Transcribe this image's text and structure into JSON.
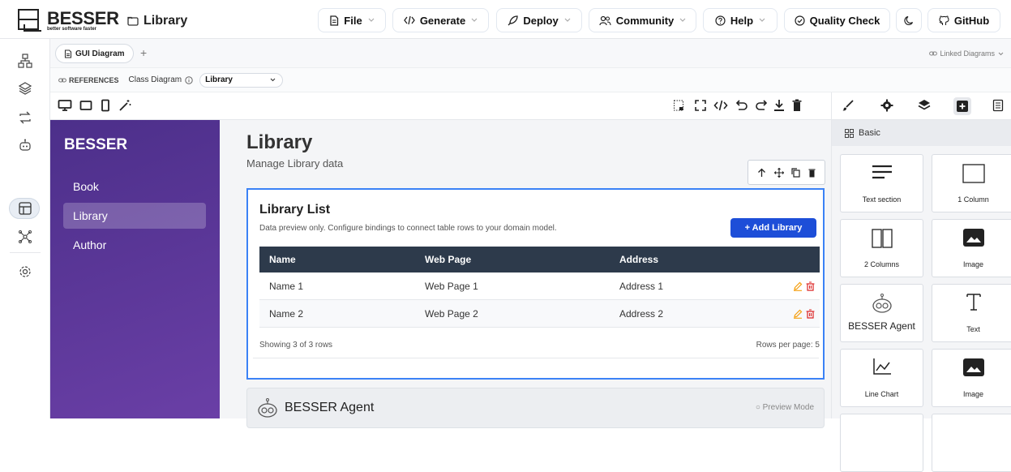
{
  "app": {
    "logo_title": "BESSER",
    "logo_subtitle": "better software faster",
    "project_name": "Library"
  },
  "menu": {
    "file": "File",
    "generate": "Generate",
    "deploy": "Deploy",
    "community": "Community",
    "help": "Help",
    "quality_check": "Quality Check",
    "github": "GitHub"
  },
  "tabs": {
    "active_tab": "GUI Diagram",
    "add": "+",
    "linked_diagrams": "Linked Diagrams"
  },
  "references": {
    "label": "REFERENCES",
    "class_diagram": "Class Diagram",
    "selected": "Library"
  },
  "sidebar": {
    "brand": "BESSER",
    "items": [
      {
        "label": "Book",
        "active": false
      },
      {
        "label": "Library",
        "active": true
      },
      {
        "label": "Author",
        "active": false
      }
    ]
  },
  "page": {
    "title": "Library",
    "subtitle": "Manage Library data"
  },
  "table_card": {
    "title": "Library List",
    "description": "Data preview only. Configure bindings to connect table rows to your domain model.",
    "add_button": "+ Add Library",
    "columns": [
      "Name",
      "Web Page",
      "Address"
    ],
    "rows": [
      [
        "Name 1",
        "Web Page 1",
        "Address 1"
      ],
      [
        "Name 2",
        "Web Page 2",
        "Address 2"
      ]
    ],
    "footer_left": "Showing 3 of 3 rows",
    "footer_right": "Rows per page: 5"
  },
  "agent_card": {
    "title": "BESSER Agent",
    "mode": "Preview Mode"
  },
  "blocks_panel": {
    "header": "Basic",
    "blocks": [
      {
        "label": "Text section",
        "icon": "text-section-icon"
      },
      {
        "label": "1 Column",
        "icon": "one-column-icon"
      },
      {
        "label": "2 Columns",
        "icon": "two-columns-icon"
      },
      {
        "label": "Image",
        "icon": "image-icon"
      },
      {
        "label": "BESSER Agent",
        "icon": "robot-icon"
      },
      {
        "label": "Text",
        "icon": "text-icon"
      },
      {
        "label": "Line Chart",
        "icon": "line-chart-icon"
      },
      {
        "label": "Image",
        "icon": "image-icon"
      }
    ]
  },
  "colors": {
    "sidebar": "#5a379a",
    "primary": "#1d4ed8",
    "table_header": "#2d3a4b",
    "selection": "#3b82f6",
    "edit": "#f59e0b",
    "delete": "#dc2626"
  }
}
